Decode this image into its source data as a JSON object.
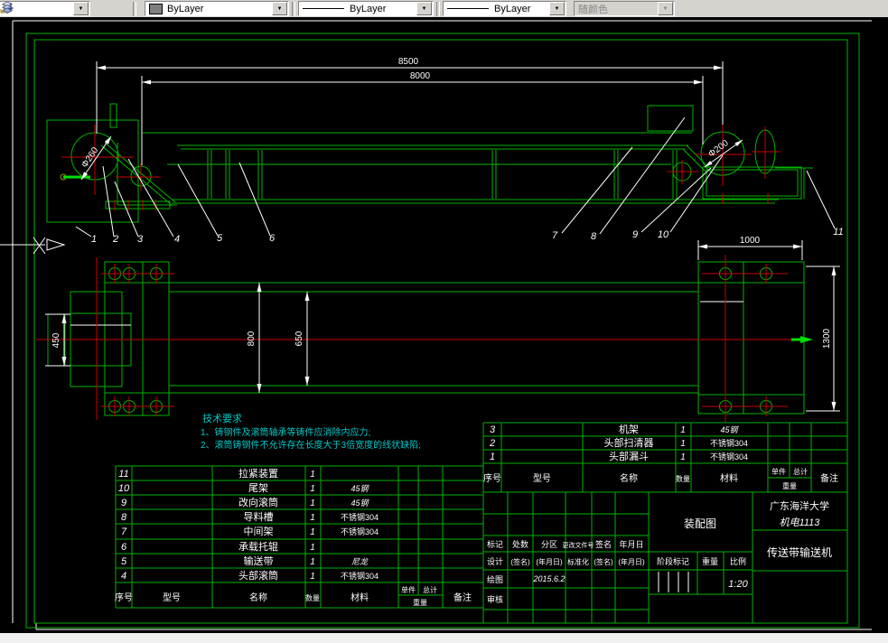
{
  "toolbar": {
    "color": {
      "value": "ByLayer"
    },
    "linetype": {
      "value": "ByLayer"
    },
    "lineweight": {
      "value": "ByLayer"
    },
    "plot_style": {
      "value": "随颜色"
    }
  },
  "drawing": {
    "dimensions": {
      "length_8500": "8500",
      "length_8000": "8000",
      "width_1000": "1000",
      "width_450": "450",
      "width_800": "800",
      "width_650": "650",
      "width_1300": "1300",
      "drum_260": "Φ260",
      "drum_200": "Φ200"
    },
    "balloons": [
      "1",
      "2",
      "3",
      "4",
      "5",
      "6",
      "7",
      "8",
      "9",
      "10",
      "11"
    ],
    "technical_requirements": {
      "title": "技术要求",
      "items": [
        "1、铸钢件及滚筒轴承等铸件应消除内应力;",
        "2、滚筒铸钢件不允许存在长度大于3倍宽度的线状缺陷;"
      ]
    }
  },
  "bom": {
    "headers": {
      "no": "序号",
      "model": "型号",
      "name": "名称",
      "qty": "数量",
      "material": "材料",
      "unit": "单件",
      "total": "总计",
      "weight": "重量",
      "remark": "备注"
    },
    "left_rows": [
      {
        "no": "11",
        "name": "拉紧装置",
        "qty": "1",
        "material": ""
      },
      {
        "no": "10",
        "name": "尾架",
        "qty": "1",
        "material": "45钢"
      },
      {
        "no": "9",
        "name": "改向滚筒",
        "qty": "1",
        "material": "45钢"
      },
      {
        "no": "8",
        "name": "导料槽",
        "qty": "1",
        "material": "不锈钢304"
      },
      {
        "no": "7",
        "name": "中间架",
        "qty": "1",
        "material": "不锈钢304"
      },
      {
        "no": "6",
        "name": "承载托辊",
        "qty": "1",
        "material": ""
      },
      {
        "no": "5",
        "name": "输送带",
        "qty": "1",
        "material": "尼龙"
      },
      {
        "no": "4",
        "name": "头部滚筒",
        "qty": "1",
        "material": "不锈钢304"
      }
    ],
    "right_rows": [
      {
        "no": "3",
        "name": "机架",
        "qty": "1",
        "material": "45钢"
      },
      {
        "no": "2",
        "name": "头部扫清器",
        "qty": "1",
        "material": "不锈钢304"
      },
      {
        "no": "1",
        "name": "头部漏斗",
        "qty": "1",
        "material": "不锈钢304"
      }
    ]
  },
  "title_block": {
    "revision_headers": [
      "标记",
      "处数",
      "分区",
      "更改文件号",
      "签名",
      "年月日"
    ],
    "design_label": "设计",
    "sign_hint": "(签名)",
    "date_hint": "(年月日)",
    "standard_label": "标准化",
    "draw_label": "绘图",
    "draw_date": "2015.6.2",
    "check_label": "审核",
    "stage_label": "阶段标记",
    "weight_label": "重量",
    "scale_label": "比例",
    "scale_value": "1:20",
    "drawing_type": "装配图",
    "university": "广东海洋大学",
    "class_name": "机电1113",
    "drawing_title": "传送带输送机"
  }
}
